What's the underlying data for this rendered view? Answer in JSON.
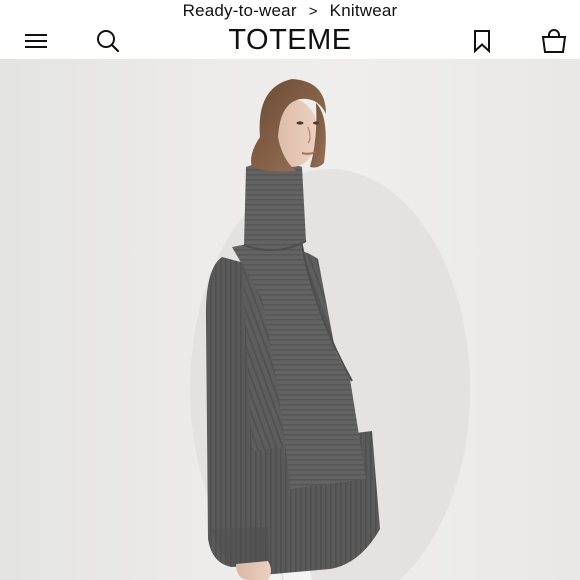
{
  "breadcrumb": {
    "items": [
      "Ready-to-wear",
      "Knitwear"
    ],
    "separator": ">"
  },
  "header": {
    "brand": "TOTEME",
    "icons": [
      "menu-icon",
      "search-icon",
      "bookmark-icon",
      "shopping-bag-icon"
    ]
  },
  "hero": {
    "image": "product-photo-model-grey-knit-sweater"
  },
  "colors": {
    "background": "#ffffff",
    "text": "#111111",
    "photo_backdrop": "#ecebe9",
    "sweater": "#5c5c5c"
  }
}
